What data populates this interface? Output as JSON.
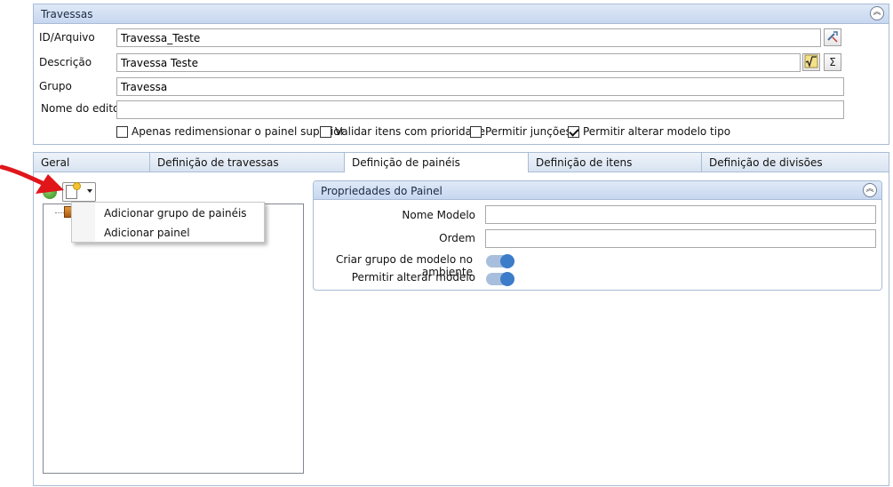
{
  "top_panel": {
    "title": "Travessas",
    "fields": {
      "id_label": "ID/Arquivo",
      "id_value": "Travessa_Teste",
      "desc_label": "Descrição",
      "desc_value": "Travessa Teste",
      "group_label": "Grupo",
      "group_value": "Travessa",
      "editor_label": "Nome do editor",
      "editor_value": ""
    },
    "sigma_symbol": "Σ",
    "checkboxes": [
      {
        "label": "Apenas redimensionar o painel superior",
        "checked": false
      },
      {
        "label": "Validar itens com prioridade",
        "checked": false
      },
      {
        "label": "Permitir junções",
        "checked": false
      },
      {
        "label": "Permitir alterar modelo tipo",
        "checked": true
      }
    ]
  },
  "tabs": [
    {
      "label": "Geral",
      "active": false
    },
    {
      "label": "Definição de travessas",
      "active": false
    },
    {
      "label": "Definição de painéis",
      "active": true
    },
    {
      "label": "Definição de itens",
      "active": false
    },
    {
      "label": "Definição de divisões",
      "active": false
    }
  ],
  "context_menu": {
    "items": [
      "Adicionar grupo de painéis",
      "Adicionar painel"
    ]
  },
  "props_panel": {
    "title": "Propriedades do Painel",
    "nome_modelo_label": "Nome Modelo",
    "nome_modelo_value": "",
    "ordem_label": "Ordem",
    "ordem_value": "",
    "criar_grupo_label": "Criar grupo de modelo no ambiente",
    "criar_grupo_on": true,
    "permitir_alterar_label": "Permitir alterar modelo",
    "permitir_alterar_on": true
  },
  "colors": {
    "header_blue": "#c7d7ef",
    "toggle_on": "#3d7cc9",
    "arrow_red": "#e0161b"
  }
}
